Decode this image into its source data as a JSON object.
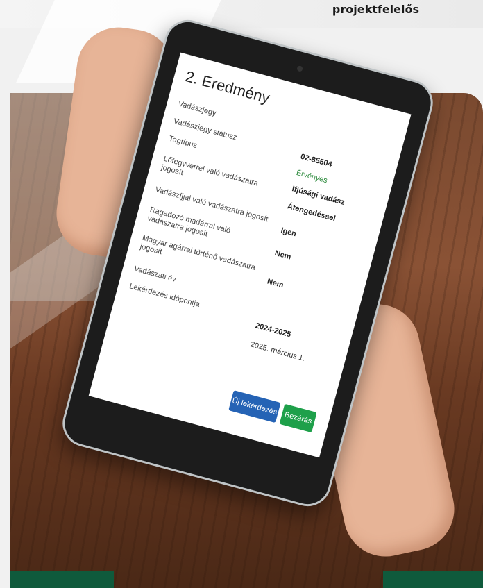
{
  "header": {
    "caption": "projektfelelős"
  },
  "result": {
    "title": "2. Eredmény",
    "rows": [
      {
        "label": "Vadászjegy",
        "value": "02-85504"
      },
      {
        "label": "Vadászjegy státusz",
        "value": "Érvényes"
      },
      {
        "label": "Tagtípus",
        "value": "Ifjúsági vadász"
      },
      {
        "label": "Lőfegyverrel való vadászatra jogosít",
        "value": "Átengedéssel"
      },
      {
        "label": "Vadászíjjal való vadászatra jogosít",
        "value": "Igen"
      },
      {
        "label": "Ragadozó madárral való vadászatra jogosít",
        "value": "Nem"
      },
      {
        "label": "Magyar agárral történő vadászatra jogosít",
        "value": "Nem"
      },
      {
        "label": "Vadászati év",
        "value": "2024-2025"
      },
      {
        "label": "Lekérdezés időpontja",
        "value": "2025. március 1."
      }
    ],
    "buttons": {
      "new_query": "Új lekérdezés",
      "close": "Bezárás"
    }
  },
  "colors": {
    "status_ok": "#2e8b3e",
    "primary": "#2563b5",
    "success": "#1ea04a",
    "brand_green": "#0f5a3c"
  }
}
